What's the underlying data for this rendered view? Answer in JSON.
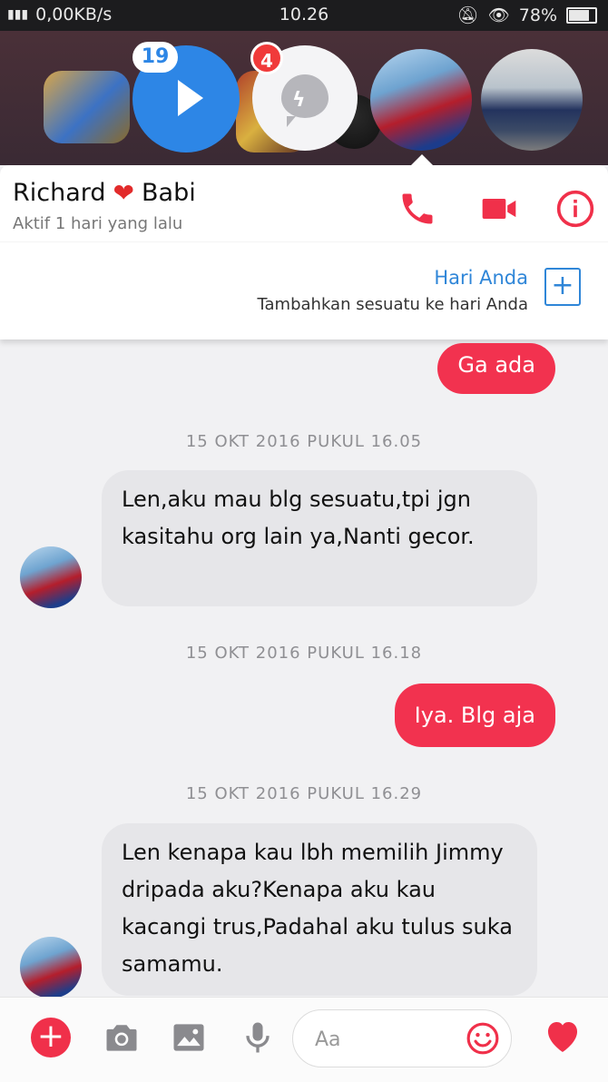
{
  "status_bar": {
    "network": "0,00KB/s",
    "time": "10.26",
    "battery": "78%"
  },
  "chat_heads": {
    "video_badge": "19",
    "messenger_badge": "4"
  },
  "header": {
    "name_first": "Richard",
    "name_emoji": "❤",
    "name_last": "Babi",
    "status": "Aktif 1 hari yang lalu",
    "story_title": "Hari Anda",
    "story_subtitle": "Tambahkan sesuatu ke hari Anda"
  },
  "messages": [
    {
      "type": "out",
      "text": "Ga ada"
    },
    {
      "type": "timestamp",
      "text": "15 OKT 2016 PUKUL 16.05"
    },
    {
      "type": "in",
      "text": "Len,aku mau blg sesuatu,tpi jgn kasitahu org lain ya,Nanti gecor."
    },
    {
      "type": "timestamp",
      "text": "15 OKT 2016 PUKUL 16.18"
    },
    {
      "type": "out",
      "text": "Iya.  Blg aja"
    },
    {
      "type": "timestamp",
      "text": "15 OKT 2016 PUKUL 16.29"
    },
    {
      "type": "in",
      "text": "Len kenapa kau lbh memilih Jimmy dripada aku?Kenapa aku kau kacangi trus,Padahal aku tulus suka samamu."
    }
  ],
  "composer": {
    "placeholder": "Aa"
  },
  "colors": {
    "accent": "#f2324f",
    "link": "#2f86d8",
    "incoming_bubble": "#e6e6e9"
  },
  "icons": [
    "phone-icon",
    "video-call-icon",
    "info-icon",
    "plus-icon",
    "camera-icon",
    "gallery-icon",
    "microphone-icon",
    "emoji-icon",
    "heart-icon"
  ]
}
